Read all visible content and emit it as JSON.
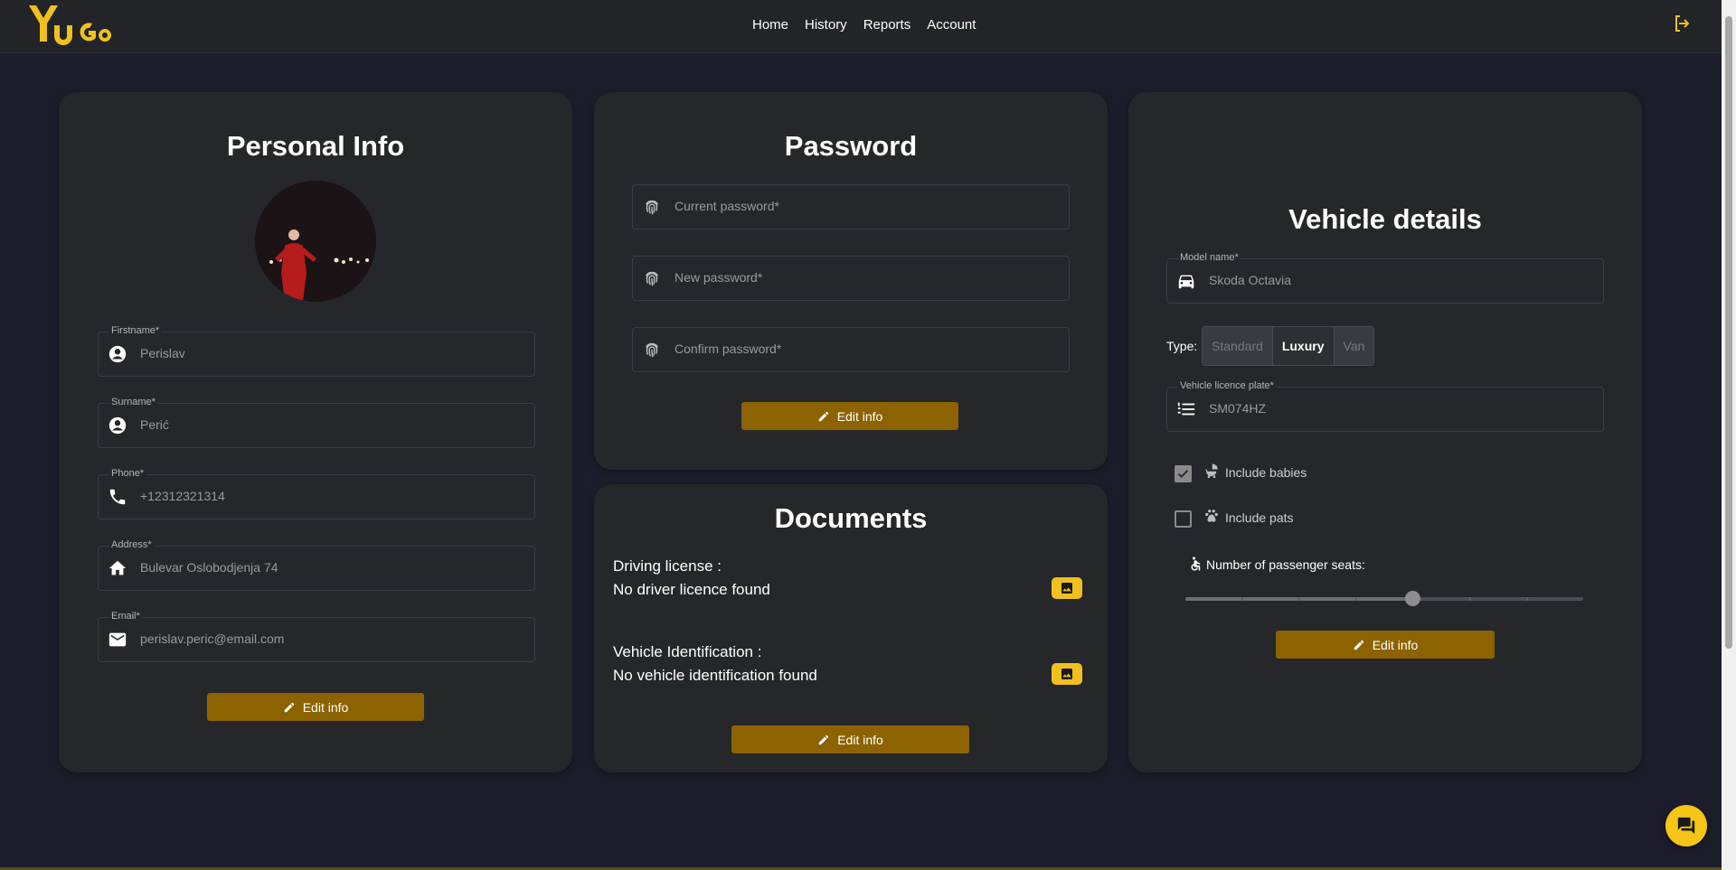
{
  "header": {
    "logo_text": "YuGo",
    "nav": [
      "Home",
      "History",
      "Reports",
      "Account"
    ]
  },
  "personal_info": {
    "title": "Personal Info",
    "fields": [
      {
        "label": "Firstname*",
        "value": "Perislav",
        "icon": "account-circle-icon"
      },
      {
        "label": "Surname*",
        "value": "Perić",
        "icon": "account-circle-icon"
      },
      {
        "label": "Phone*",
        "value": "+12312321314",
        "icon": "phone-icon"
      },
      {
        "label": "Address*",
        "value": "Bulevar Oslobodjenja 74",
        "icon": "home-icon"
      },
      {
        "label": "Email*",
        "value": "perislav.peric@email.com",
        "icon": "mail-icon"
      }
    ],
    "button": "Edit info"
  },
  "password": {
    "title": "Password",
    "fields": [
      {
        "placeholder": "Current password*",
        "icon": "fingerprint-icon"
      },
      {
        "placeholder": "New password*",
        "icon": "fingerprint-icon"
      },
      {
        "placeholder": "Confirm password*",
        "icon": "fingerprint-icon"
      }
    ],
    "button": "Edit info"
  },
  "documents": {
    "title": "Documents",
    "items": [
      {
        "label": "Driving license :",
        "status": "No driver licence found"
      },
      {
        "label": "Vehicle Identification :",
        "status": "No vehicle identification found"
      }
    ],
    "button": "Edit info"
  },
  "vehicle": {
    "title": "Vehicle details",
    "model": {
      "label": "Model name*",
      "value": "Skoda Octavia"
    },
    "type_label": "Type:",
    "types": [
      "Standard",
      "Luxury",
      "Van"
    ],
    "selected_type": "Luxury",
    "plate": {
      "label": "Vehicle licence plate*",
      "value": "SM074HZ"
    },
    "options": [
      {
        "label": "Include babies",
        "checked": true,
        "icon": "stroller-icon"
      },
      {
        "label": "Include pats",
        "checked": false,
        "icon": "paw-icon"
      }
    ],
    "seats_label": "Number of passenger seats:",
    "seats_fraction": 0.57,
    "button": "Edit info"
  },
  "colors": {
    "background": "#1c1d2b",
    "card": "#26272b",
    "accent": "#8c6300",
    "accent_bright": "#f5c518"
  }
}
